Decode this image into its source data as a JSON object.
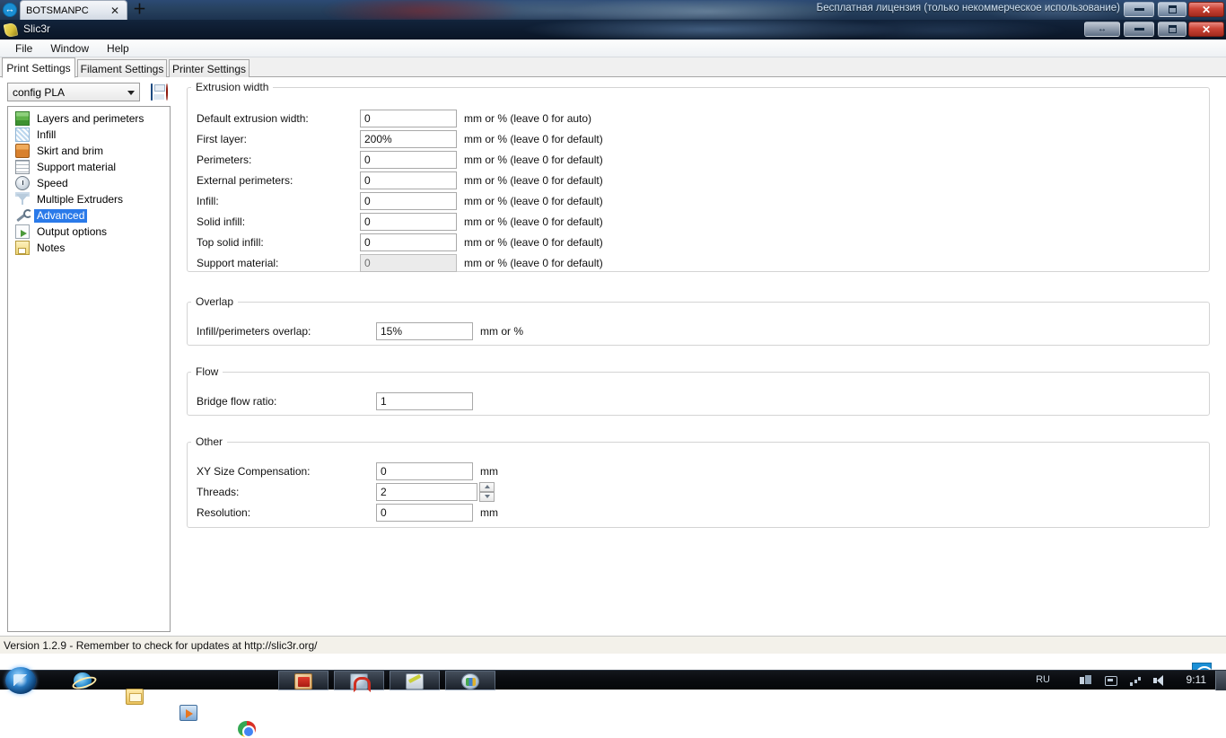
{
  "remote_bar": {
    "icon": "teamviewer-arrows-icon",
    "tab_label": "BOTSMANPC",
    "tab_close": "✕",
    "new_tab": "＋",
    "license_text": "Бесплатная лицензия (только некоммерческое использование)",
    "close_label": "✕"
  },
  "window": {
    "title": "Slic3r",
    "app_icon": "slic3r-logo-icon",
    "restore_label": "↔",
    "close_label": "✕"
  },
  "menu": {
    "items": [
      {
        "label": "File"
      },
      {
        "label": "Window"
      },
      {
        "label": "Help"
      }
    ]
  },
  "tabs": [
    {
      "label": "Print Settings",
      "active": true
    },
    {
      "label": "Filament Settings",
      "active": false
    },
    {
      "label": "Printer Settings",
      "active": false
    }
  ],
  "preset": {
    "value": "config PLA",
    "save_icon": "floppy-save-icon",
    "delete_icon": "delete-circle-icon"
  },
  "tree": {
    "items": [
      {
        "label": "Layers and perimeters",
        "icon": "layers-icon",
        "selected": false
      },
      {
        "label": "Infill",
        "icon": "infill-icon",
        "selected": false
      },
      {
        "label": "Skirt and brim",
        "icon": "skirt-icon",
        "selected": false
      },
      {
        "label": "Support material",
        "icon": "support-icon",
        "selected": false
      },
      {
        "label": "Speed",
        "icon": "clock-icon",
        "selected": false
      },
      {
        "label": "Multiple Extruders",
        "icon": "funnel-icon",
        "selected": false
      },
      {
        "label": "Advanced",
        "icon": "wrench-icon",
        "selected": true
      },
      {
        "label": "Output options",
        "icon": "output-icon",
        "selected": false
      },
      {
        "label": "Notes",
        "icon": "notes-icon",
        "selected": false
      }
    ]
  },
  "groups": {
    "extrusion": {
      "title": "Extrusion width",
      "rows": [
        {
          "label": "Default extrusion width:",
          "value": "0",
          "unit": "mm or % (leave 0 for auto)",
          "disabled": false
        },
        {
          "label": "First layer:",
          "value": "200%",
          "unit": "mm or % (leave 0 for default)",
          "disabled": false
        },
        {
          "label": "Perimeters:",
          "value": "0",
          "unit": "mm or % (leave 0 for default)",
          "disabled": false
        },
        {
          "label": "External perimeters:",
          "value": "0",
          "unit": "mm or % (leave 0 for default)",
          "disabled": false
        },
        {
          "label": "Infill:",
          "value": "0",
          "unit": "mm or % (leave 0 for default)",
          "disabled": false
        },
        {
          "label": "Solid infill:",
          "value": "0",
          "unit": "mm or % (leave 0 for default)",
          "disabled": false
        },
        {
          "label": "Top solid infill:",
          "value": "0",
          "unit": "mm or % (leave 0 for default)",
          "disabled": false
        },
        {
          "label": "Support material:",
          "value": "0",
          "unit": "mm or % (leave 0 for default)",
          "disabled": true
        }
      ]
    },
    "overlap": {
      "title": "Overlap",
      "rows": [
        {
          "label": "Infill/perimeters overlap:",
          "value": "15%",
          "unit": "mm or %"
        }
      ]
    },
    "flow": {
      "title": "Flow",
      "rows": [
        {
          "label": "Bridge flow ratio:",
          "value": "1",
          "unit": ""
        }
      ]
    },
    "other": {
      "title": "Other",
      "rows": [
        {
          "label": "XY Size Compensation:",
          "value": "0",
          "unit": "mm",
          "spinner": false
        },
        {
          "label": "Threads:",
          "value": "2",
          "unit": "",
          "spinner": true
        },
        {
          "label": "Resolution:",
          "value": "0",
          "unit": "mm",
          "spinner": false
        }
      ]
    }
  },
  "statusbar": {
    "text": "Version 1.2.9 - Remember to check for updates at http://slic3r.org/"
  },
  "overlay_widget": {
    "icon": "teamviewer-arrows-icon"
  },
  "taskbar": {
    "start_icon": "windows-start-orb-icon",
    "quicklaunch": [
      {
        "icon": "internet-explorer-icon"
      },
      {
        "icon": "folder-icon"
      },
      {
        "icon": "windows-media-player-icon"
      },
      {
        "icon": "google-chrome-icon"
      }
    ],
    "windows": [
      {
        "icon": "cube-app-icon"
      },
      {
        "icon": "magnet-app-icon"
      },
      {
        "icon": "pencil-app-icon"
      },
      {
        "icon": "paint-app-icon"
      }
    ],
    "tray": {
      "language": "RU",
      "icons": [
        {
          "icon": "network-icon"
        },
        {
          "icon": "monitor-icon"
        },
        {
          "icon": "signal-icon"
        },
        {
          "icon": "volume-icon"
        }
      ],
      "clock": "9:11"
    }
  }
}
